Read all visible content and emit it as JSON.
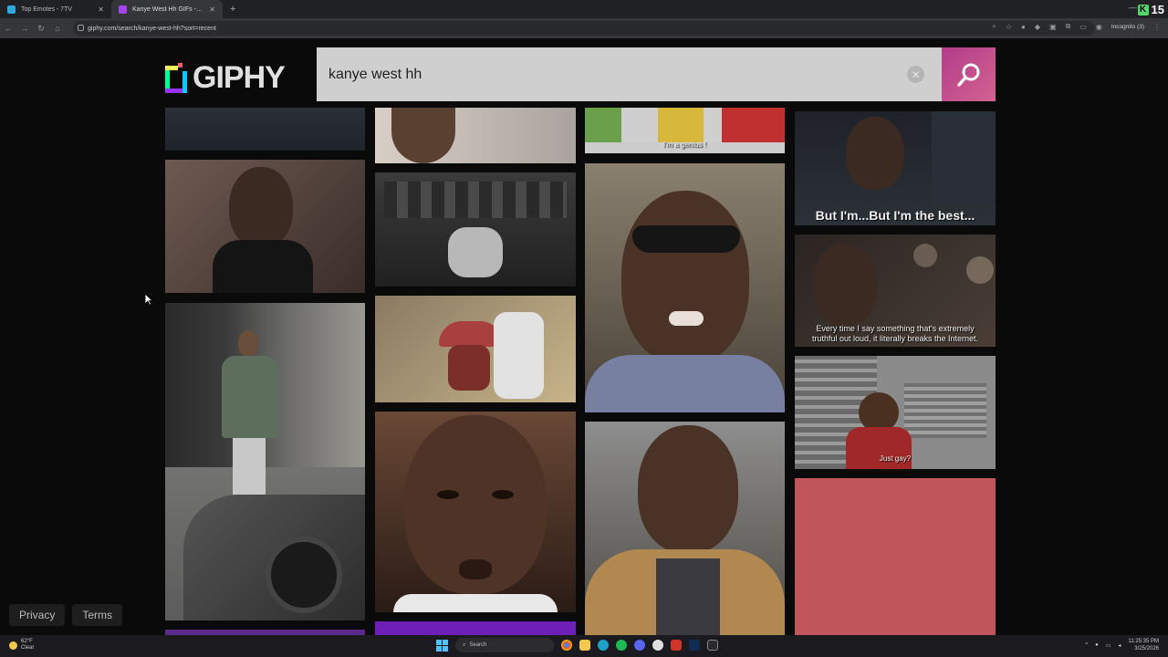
{
  "browser": {
    "tabs": [
      {
        "title": "Top Emotes - 7TV",
        "active": false,
        "favicon_color": "#2ea9dd"
      },
      {
        "title": "Kanye West Hh GIFs - Find & Share on GIPHY",
        "active": true,
        "favicon_color": "#a445ee"
      }
    ],
    "new_tab": "+",
    "url": "giphy.com/search/kanye-west-hh?sort=recent",
    "incognito_label": "Incognito (3)",
    "badge_number": "15",
    "badge_letter": "K"
  },
  "giphy": {
    "logo_text": "GIPHY",
    "search": {
      "value": "kanye west hh"
    }
  },
  "gifs": {
    "col3_top_caption": "I'm a genius !",
    "col4_caption_1": "But I'm...But I'm the best...",
    "col4_caption_2_line1": "Every time I say something that's extremely",
    "col4_caption_2_line2": "truthful out loud, it literally breaks the Internet.",
    "col4_caption_3": "Just gay?",
    "placeholder_color": "#c0565c"
  },
  "footer": {
    "privacy": "Privacy",
    "terms": "Terms"
  },
  "taskbar": {
    "temp": "62°F",
    "weather": "Clear",
    "search": "Search",
    "time": "11:25:35 PM",
    "date": "3/25/2026"
  }
}
